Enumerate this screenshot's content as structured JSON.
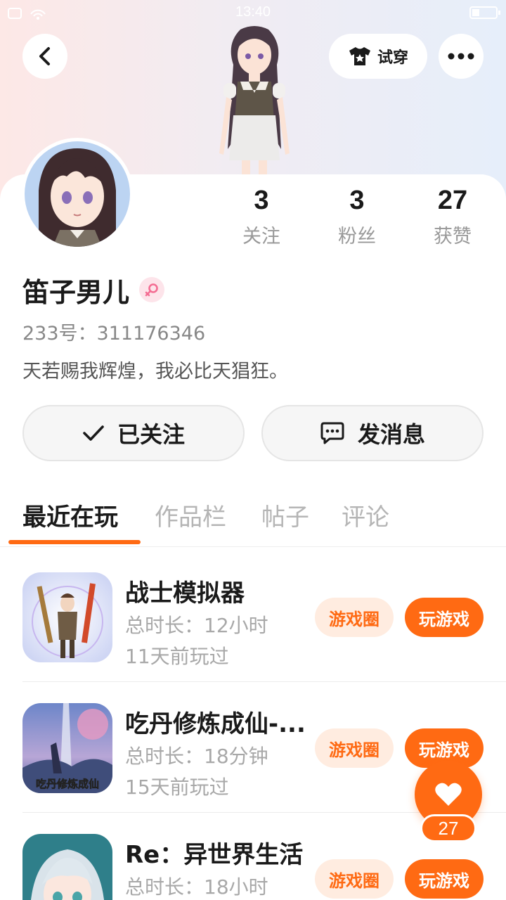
{
  "status_bar": {
    "time": "13:40"
  },
  "header": {
    "try_on_label": "试穿"
  },
  "profile": {
    "name": "笛子男儿",
    "uid": "233号：311176346",
    "bio": "天若赐我辉煌，我必比天猖狂。",
    "stats": [
      {
        "value": "3",
        "label": "关注"
      },
      {
        "value": "3",
        "label": "粉丝"
      },
      {
        "value": "27",
        "label": "获赞"
      }
    ]
  },
  "actions": {
    "follow_label": "已关注",
    "message_label": "发消息"
  },
  "tabs": [
    {
      "label": "最近在玩",
      "active": true
    },
    {
      "label": "作品栏",
      "active": false
    },
    {
      "label": "帖子",
      "active": false
    },
    {
      "label": "评论",
      "active": false
    }
  ],
  "games": [
    {
      "title": "战士模拟器",
      "duration": "总时长：12小时",
      "last_played": "11天前玩过",
      "circle_label": "游戏圈",
      "play_label": "玩游戏"
    },
    {
      "title": "吃丹修炼成仙-...",
      "duration": "总时长：18分钟",
      "last_played": "15天前玩过",
      "circle_label": "游戏圈",
      "play_label": "玩游戏",
      "icon_caption": "吃丹修炼成仙"
    },
    {
      "title": "Re：异世界生活",
      "duration": "总时长：18小时",
      "last_played": "",
      "circle_label": "游戏圈",
      "play_label": "玩游戏"
    }
  ],
  "like_fab": {
    "count": "27"
  },
  "colors": {
    "accent": "#ff6a13",
    "accent_light": "#ffece0",
    "gender": "#f46d93"
  }
}
